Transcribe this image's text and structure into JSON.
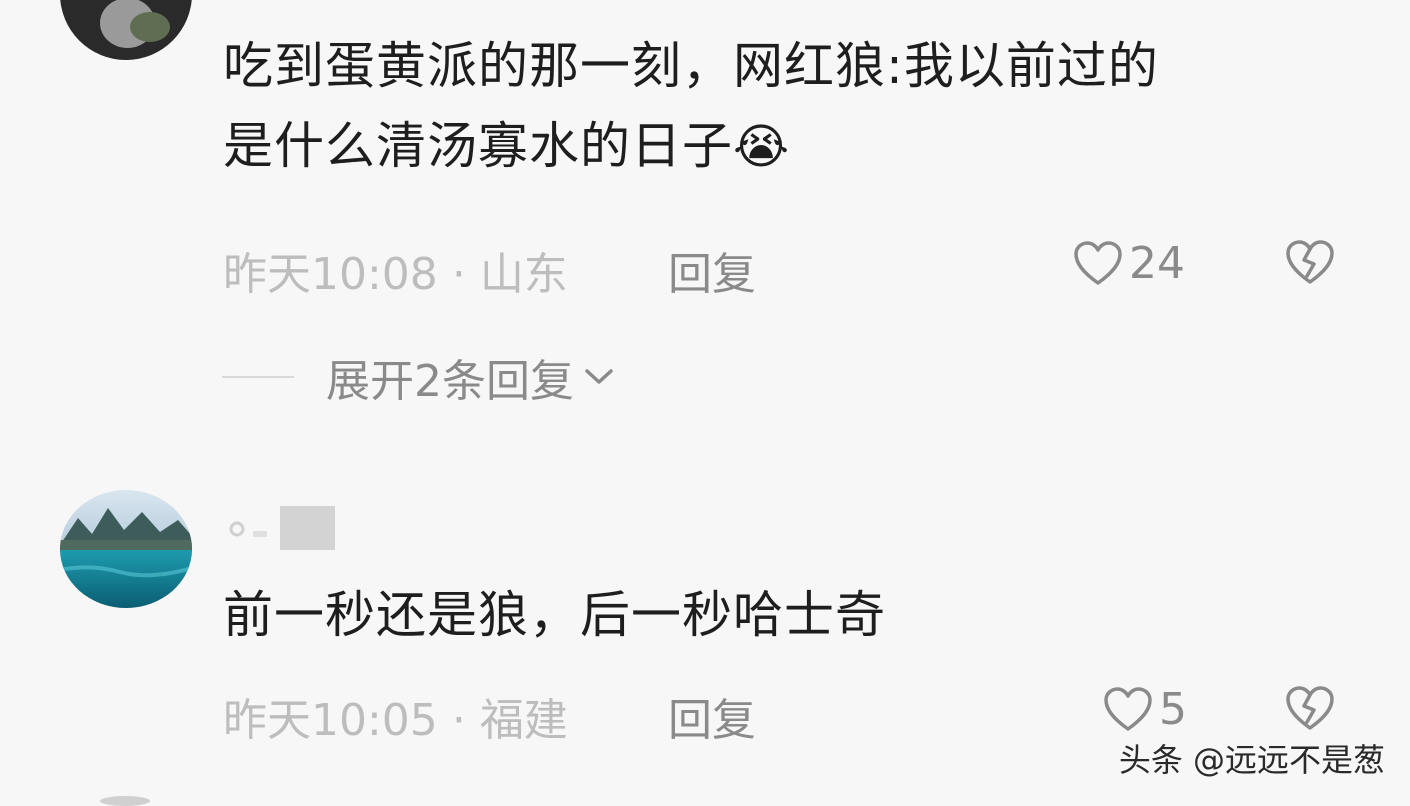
{
  "comments": [
    {
      "text_line1": "吃到蛋黄派的那一刻，网红狼:我以前过的",
      "text_line2": "是什么清汤寡水的日子",
      "emoji": "😭",
      "time": "昨天10:08",
      "separator": "·",
      "location": "山东",
      "reply_label": "回复",
      "likes": "24",
      "expand_label": "展开2条回复"
    },
    {
      "text": "前一秒还是狼，后一秒哈士奇",
      "time": "昨天10:05",
      "separator": "·",
      "location": "福建",
      "reply_label": "回复",
      "likes": "5"
    }
  ],
  "watermark": "头条 @远远不是葱",
  "icons": {
    "like": "heart-outline-icon",
    "dislike": "broken-heart-icon",
    "expand": "chevron-down-icon"
  },
  "colors": {
    "text": "#1e1e1e",
    "meta": "#bdbdbd",
    "action": "#8a8a8a",
    "background": "#f7f7f7"
  }
}
